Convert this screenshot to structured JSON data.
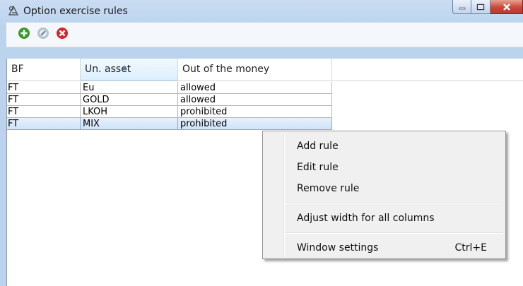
{
  "window": {
    "title": "Option exercise rules",
    "icon": "option-rules-icon"
  },
  "toolbar": {
    "buttons": [
      {
        "name": "add-icon",
        "color": "#3a9a2f"
      },
      {
        "name": "edit-icon",
        "color": "#8c9aa8"
      },
      {
        "name": "delete-icon",
        "color": "#d6232d"
      }
    ]
  },
  "table": {
    "columns": [
      "BF",
      "Un. asset",
      "Out of the money"
    ],
    "sorted_column": "Un. asset",
    "rows": [
      {
        "bf": "FT",
        "asset": "Eu",
        "otm": "allowed"
      },
      {
        "bf": "FT",
        "asset": "GOLD",
        "otm": "allowed"
      },
      {
        "bf": "FT",
        "asset": "LKOH",
        "otm": "prohibited"
      },
      {
        "bf": "FT",
        "asset": "MIX",
        "otm": "prohibited",
        "selected": true
      }
    ]
  },
  "context_menu": {
    "items": [
      {
        "label": "Add rule"
      },
      {
        "label": "Edit rule"
      },
      {
        "label": "Remove rule"
      },
      {
        "label": "Adjust width for all columns"
      },
      {
        "label": "Window settings",
        "shortcut": "Ctrl+E"
      }
    ]
  }
}
